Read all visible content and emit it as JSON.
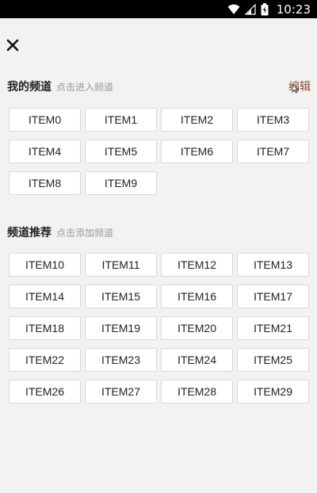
{
  "status": {
    "time": "10:23"
  },
  "header": {
    "close_icon": "close-icon"
  },
  "my_channels": {
    "title": "我的频道",
    "hint": "点击进入频道",
    "edit_label": "编辑",
    "items": [
      "ITEM0",
      "ITEM1",
      "ITEM2",
      "ITEM3",
      "ITEM4",
      "ITEM5",
      "ITEM6",
      "ITEM7",
      "ITEM8",
      "ITEM9"
    ]
  },
  "recommended": {
    "title": "频道推荐",
    "hint": "点击添加频道",
    "items": [
      "ITEM10",
      "ITEM11",
      "ITEM12",
      "ITEM13",
      "ITEM14",
      "ITEM15",
      "ITEM16",
      "ITEM17",
      "ITEM18",
      "ITEM19",
      "ITEM20",
      "ITEM21",
      "ITEM22",
      "ITEM23",
      "ITEM24",
      "ITEM25",
      "ITEM26",
      "ITEM27",
      "ITEM28",
      "ITEM29"
    ]
  }
}
